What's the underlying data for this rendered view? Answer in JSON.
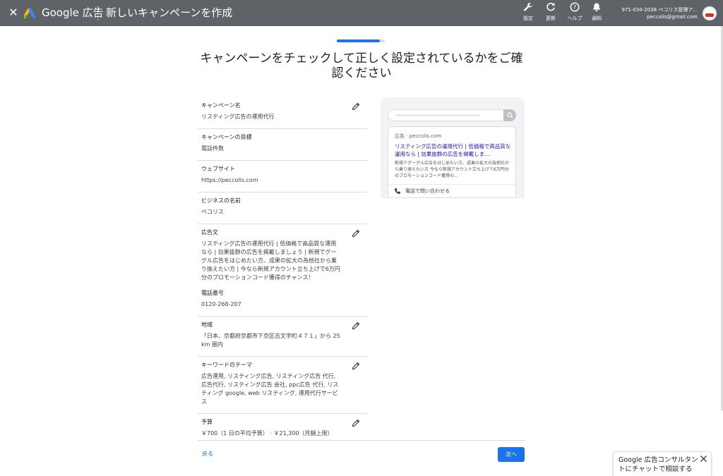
{
  "header": {
    "brand": "Google 広告",
    "title": "新しいキャンペーンを作成",
    "tools": [
      {
        "label": "設定",
        "icon": "wrench-icon"
      },
      {
        "label": "更新",
        "icon": "refresh-icon"
      },
      {
        "label": "ヘルプ",
        "icon": "help-icon"
      },
      {
        "label": "通知",
        "icon": "bell-icon"
      }
    ],
    "account_id": "971-034-2038 ペコリス管理ア...",
    "account_email": "peccolis@gmail.com"
  },
  "progress": {
    "fraction": 0.9
  },
  "page": {
    "title": "キャンペーンをチェックして正しく設定されているかをご確認ください"
  },
  "summary": {
    "campaign_name": {
      "label": "キャンペーン名",
      "value": "リスティング広告の運用代行"
    },
    "goal": {
      "label": "キャンペーンの目標",
      "value": "電話件数"
    },
    "website": {
      "label": "ウェブサイト",
      "value": "https://peccolis.com"
    },
    "business_name": {
      "label": "ビジネスの名前",
      "value": "ペコリス"
    },
    "ad_text": {
      "label": "広告文",
      "value": "リスティング広告の運用代行 | 低価格で高品質な運用なら | 効果抜群の広告を掲載しましょう | 新規でグーグル広告をはじめたい方、成果の拡大の為他社から乗り換えたい方 | 今なら新規アカウント立ち上げで6万円分のプロモーションコード獲得のチャンス！",
      "phone_label": "電話番号",
      "phone": "0120-268-207"
    },
    "region": {
      "label": "地域",
      "value": "「日本、京都府京都市下京区吉文字町４７１」から 25 km 圏内"
    },
    "keywords": {
      "label": "キーワードのテーマ",
      "value": "広告運用, リスティング広告, リスティング広告 代行, 広告代行, リスティング広告 会社, ppc広告 代行, リスティング google, web リスティング, 運用代行サービス"
    },
    "budget": {
      "label": "予算",
      "value": "￥700（1 日の平均予算） · ￥21,300（月額上限）"
    }
  },
  "preview": {
    "url": "広告 · peccolis.com",
    "headline": "リスティング広告の運用代行 | 低価格で高品質な運用なら | 効果抜群の広告を掲載しま...",
    "description": "新規でグーグル広告をはじめたい方、成果の拡大の為他社から乗り換えたい方 今なら新規アカウント立ち上げで6万円分のプロモーションコード獲得の...",
    "call_label": "電話で問い合わせる"
  },
  "footer": {
    "back_label": "戻る",
    "next_label": "次へ"
  },
  "chat": {
    "text": "Google 広告コンサルタントにチャットで相談する"
  },
  "colors": {
    "topbar": "#5f6368",
    "accent": "#1a73e8",
    "ad_headline": "#1a0dab"
  }
}
